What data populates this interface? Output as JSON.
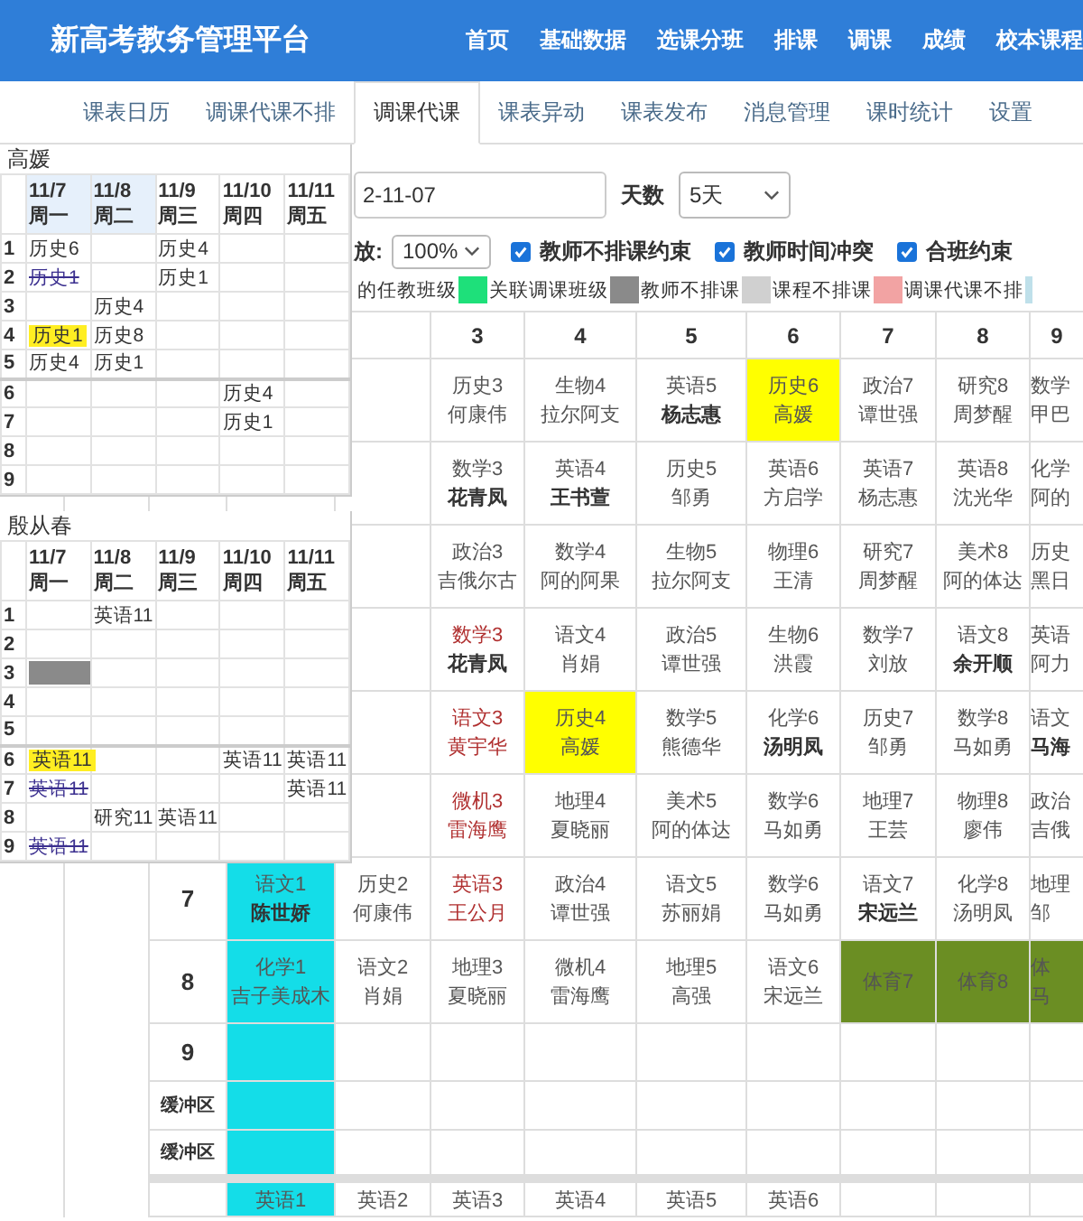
{
  "app": {
    "title": "新高考教务管理平台",
    "nav": [
      "首页",
      "基础数据",
      "选课分班",
      "排课",
      "调课",
      "成绩",
      "校本课程"
    ]
  },
  "tabs": [
    {
      "label": "课表日历",
      "selected": false
    },
    {
      "label": "调课代课不排",
      "selected": false
    },
    {
      "label": "调课代课",
      "selected": true
    },
    {
      "label": "课表异动",
      "selected": false
    },
    {
      "label": "课表发布",
      "selected": false
    },
    {
      "label": "消息管理",
      "selected": false
    },
    {
      "label": "课时统计",
      "selected": false
    },
    {
      "label": "设置",
      "selected": false
    }
  ],
  "toolbar": {
    "date_value": "2-11-07",
    "days_label": "天数",
    "days_value": "5天",
    "zoom_label": "放:",
    "zoom_value": "100%",
    "checkboxes": [
      {
        "label": "教师不排课约束",
        "checked": true
      },
      {
        "label": "教师时间冲突",
        "checked": true
      },
      {
        "label": "合班约束",
        "checked": true
      }
    ]
  },
  "legend": [
    {
      "label": "的任教班级"
    },
    {
      "label": "关联调课班级",
      "color": "#1ee07a"
    },
    {
      "label": "教师不排课",
      "color": "#8a8a8a"
    },
    {
      "label": "课程不排课",
      "color": "#d0d0d0"
    },
    {
      "label": "调课代课不排",
      "color": "#f2a3a3"
    },
    {
      "color": "#bfe0ea"
    }
  ],
  "timetable": {
    "columns": [
      null,
      null,
      "3",
      "4",
      "5",
      "6",
      "7",
      "8",
      "9"
    ],
    "rows": [
      {
        "period": null,
        "cells": [
          null,
          null,
          {
            "subject": "历史3",
            "teacher": "何康伟"
          },
          {
            "subject": "生物4",
            "teacher": "拉尔阿支"
          },
          {
            "subject": "英语5",
            "teacher": "杨志惠",
            "teacher_bold": true
          },
          {
            "subject": "历史6",
            "teacher": "高媛",
            "color": "#ffff00"
          },
          {
            "subject": "政治7",
            "teacher": "谭世强"
          },
          {
            "subject": "研究8",
            "teacher": "周梦醒"
          },
          {
            "subject": "数学",
            "teacher": "甲巴"
          }
        ]
      },
      {
        "period": null,
        "cells": [
          null,
          null,
          {
            "subject": "数学3",
            "teacher": "花青凤",
            "teacher_bold": true
          },
          {
            "subject": "英语4",
            "teacher": "王书萱",
            "teacher_bold": true
          },
          {
            "subject": "历史5",
            "teacher": "邹勇"
          },
          {
            "subject": "英语6",
            "teacher": "方启学"
          },
          {
            "subject": "英语7",
            "teacher": "杨志惠"
          },
          {
            "subject": "英语8",
            "teacher": "沈光华"
          },
          {
            "subject": "化学",
            "teacher": "阿的"
          }
        ]
      },
      {
        "period": null,
        "cells": [
          null,
          null,
          {
            "subject": "政治3",
            "teacher": "吉俄尔古"
          },
          {
            "subject": "数学4",
            "teacher": "阿的阿果"
          },
          {
            "subject": "生物5",
            "teacher": "拉尔阿支"
          },
          {
            "subject": "物理6",
            "teacher": "王清"
          },
          {
            "subject": "研究7",
            "teacher": "周梦醒"
          },
          {
            "subject": "美术8",
            "teacher": "阿的体达"
          },
          {
            "subject": "历史",
            "teacher": "黑日"
          }
        ]
      },
      {
        "period": null,
        "cells": [
          null,
          null,
          {
            "subject": "数学3",
            "teacher": "花青凤",
            "teacher_bold": true,
            "warning": true
          },
          {
            "subject": "语文4",
            "teacher": "肖娟"
          },
          {
            "subject": "政治5",
            "teacher": "谭世强"
          },
          {
            "subject": "生物6",
            "teacher": "洪霞"
          },
          {
            "subject": "数学7",
            "teacher": "刘放"
          },
          {
            "subject": "语文8",
            "teacher": "余开顺",
            "teacher_bold": true
          },
          {
            "subject": "英语",
            "teacher": "阿力"
          }
        ]
      },
      {
        "period": null,
        "cells": [
          null,
          null,
          {
            "subject": "语文3",
            "teacher": "黄宇华",
            "warning": true
          },
          {
            "subject": "历史4",
            "teacher": "高媛",
            "color": "#ffff00"
          },
          {
            "subject": "数学5",
            "teacher": "熊德华"
          },
          {
            "subject": "化学6",
            "teacher": "汤明凤",
            "teacher_bold": true
          },
          {
            "subject": "历史7",
            "teacher": "邹勇"
          },
          {
            "subject": "数学8",
            "teacher": "马如勇"
          },
          {
            "subject": "语文",
            "teacher": "马海",
            "teacher_bold": true
          }
        ]
      },
      {
        "period": null,
        "cells": [
          null,
          null,
          {
            "subject": "微机3",
            "teacher": "雷海鹰",
            "warning": true
          },
          {
            "subject": "地理4",
            "teacher": "夏晓丽"
          },
          {
            "subject": "美术5",
            "teacher": "阿的体达"
          },
          {
            "subject": "数学6",
            "teacher": "马如勇"
          },
          {
            "subject": "地理7",
            "teacher": "王芸"
          },
          {
            "subject": "物理8",
            "teacher": "廖伟"
          },
          {
            "subject": "政治",
            "teacher": "吉俄"
          }
        ]
      },
      {
        "period": "7",
        "cells": [
          {
            "subject": "语文1",
            "teacher": "陈世娇",
            "teacher_bold": true,
            "color": "#14dde8"
          },
          {
            "subject": "历史2",
            "teacher": "何康伟"
          },
          {
            "subject": "英语3",
            "teacher": "王公月",
            "warning": true
          },
          {
            "subject": "政治4",
            "teacher": "谭世强"
          },
          {
            "subject": "语文5",
            "teacher": "苏丽娟"
          },
          {
            "subject": "数学6",
            "teacher": "马如勇"
          },
          {
            "subject": "语文7",
            "teacher": "宋远兰",
            "teacher_bold": true
          },
          {
            "subject": "化学8",
            "teacher": "汤明凤"
          },
          {
            "subject": "地理",
            "teacher": "邹"
          }
        ]
      },
      {
        "period": "8",
        "cells": [
          {
            "subject": "化学1",
            "teacher": "吉子美成木",
            "color": "#14dde8"
          },
          {
            "subject": "语文2",
            "teacher": "肖娟"
          },
          {
            "subject": "地理3",
            "teacher": "夏晓丽"
          },
          {
            "subject": "微机4",
            "teacher": "雷海鹰"
          },
          {
            "subject": "地理5",
            "teacher": "高强"
          },
          {
            "subject": "语文6",
            "teacher": "宋远兰"
          },
          {
            "subject": "体育7",
            "color": "#6b8e23"
          },
          {
            "subject": "体育8",
            "color": "#6b8e23"
          },
          {
            "subject": "体",
            "teacher": "马",
            "color": "#6b8e23"
          }
        ]
      },
      {
        "period": "9",
        "kind": "short",
        "cells": [
          {
            "color": "#14dde8"
          },
          null,
          null,
          null,
          null,
          null,
          null,
          null,
          null
        ]
      },
      {
        "period": "缓冲区",
        "kind": "buffer",
        "cells": [
          {
            "color": "#14dde8"
          },
          null,
          null,
          null,
          null,
          null,
          null,
          null,
          null
        ]
      },
      {
        "period": "缓冲区",
        "kind": "buffer",
        "cells": [
          {
            "color": "#14dde8"
          },
          null,
          null,
          null,
          null,
          null,
          null,
          null,
          null
        ]
      },
      {
        "period": null,
        "kind": "cut",
        "group_start": true,
        "cells": [
          {
            "subject": "英语1",
            "color": "#14dde8"
          },
          {
            "subject": "英语2"
          },
          {
            "subject": "英语3"
          },
          {
            "subject": "英语4"
          },
          {
            "subject": "英语5"
          },
          {
            "subject": "英语6"
          },
          null,
          null,
          null
        ]
      }
    ]
  },
  "teacher_panels": [
    {
      "name": "高媛",
      "days": [
        {
          "date": "11/7",
          "weekday": "周一",
          "highlighted": true
        },
        {
          "date": "11/8",
          "weekday": "周二",
          "highlighted": true
        },
        {
          "date": "11/9",
          "weekday": "周三",
          "highlighted": false
        },
        {
          "date": "11/10",
          "weekday": "周四",
          "highlighted": false
        },
        {
          "date": "11/11",
          "weekday": "周五",
          "highlighted": false
        }
      ],
      "rows": [
        {
          "period": "1",
          "cells": [
            {
              "text": "历史6",
              "kind": "normal"
            },
            null,
            {
              "text": "历史4",
              "kind": "normal"
            },
            null,
            null
          ]
        },
        {
          "period": "2",
          "cells": [
            {
              "text": "历史1",
              "kind": "removed"
            },
            null,
            {
              "text": "历史1",
              "kind": "normal"
            },
            null,
            null
          ]
        },
        {
          "period": "3",
          "cells": [
            null,
            {
              "text": "历史4",
              "kind": "normal"
            },
            null,
            null,
            null
          ]
        },
        {
          "period": "4",
          "cells": [
            {
              "text": "历史1",
              "kind": "current"
            },
            {
              "text": "历史8",
              "kind": "normal"
            },
            null,
            null,
            null
          ]
        },
        {
          "period": "5",
          "cells": [
            {
              "text": "历史4",
              "kind": "normal"
            },
            {
              "text": "历史1",
              "kind": "normal"
            },
            null,
            null,
            null
          ]
        },
        {
          "period": "6",
          "cells": [
            null,
            null,
            null,
            {
              "text": "历史4",
              "kind": "normal"
            },
            null
          ]
        },
        {
          "period": "7",
          "cells": [
            null,
            null,
            null,
            {
              "text": "历史1",
              "kind": "normal"
            },
            null
          ]
        },
        {
          "period": "8",
          "cells": [
            null,
            null,
            null,
            null,
            null
          ]
        },
        {
          "period": "9",
          "cells": [
            null,
            null,
            null,
            null,
            null
          ]
        }
      ]
    },
    {
      "name": "殷从春",
      "days": [
        {
          "date": "11/7",
          "weekday": "周一",
          "highlighted": false
        },
        {
          "date": "11/8",
          "weekday": "周二",
          "highlighted": false
        },
        {
          "date": "11/9",
          "weekday": "周三",
          "highlighted": false
        },
        {
          "date": "11/10",
          "weekday": "周四",
          "highlighted": false
        },
        {
          "date": "11/11",
          "weekday": "周五",
          "highlighted": false
        }
      ],
      "rows": [
        {
          "period": "1",
          "cells": [
            null,
            {
              "text": "英语11",
              "kind": "normal"
            },
            null,
            null,
            null
          ]
        },
        {
          "period": "2",
          "cells": [
            null,
            null,
            null,
            null,
            null
          ]
        },
        {
          "period": "3",
          "cells": [
            {
              "kind": "blocked"
            },
            null,
            null,
            null,
            null
          ]
        },
        {
          "period": "4",
          "cells": [
            null,
            null,
            null,
            null,
            null
          ]
        },
        {
          "period": "5",
          "cells": [
            null,
            null,
            null,
            null,
            null
          ]
        },
        {
          "period": "6",
          "cells": [
            {
              "text": "英语11",
              "kind": "current"
            },
            null,
            null,
            {
              "text": "英语11",
              "kind": "normal"
            },
            {
              "text": "英语11",
              "kind": "normal"
            }
          ]
        },
        {
          "period": "7",
          "cells": [
            {
              "text": "英语11",
              "kind": "removed"
            },
            null,
            null,
            null,
            {
              "text": "英语11",
              "kind": "normal"
            }
          ]
        },
        {
          "period": "8",
          "cells": [
            null,
            {
              "text": "研究11",
              "kind": "normal"
            },
            {
              "text": "英语11",
              "kind": "normal"
            },
            null,
            null
          ]
        },
        {
          "period": "9",
          "cells": [
            {
              "text": "英语11",
              "kind": "removed"
            },
            null,
            null,
            null,
            null
          ]
        }
      ]
    }
  ]
}
